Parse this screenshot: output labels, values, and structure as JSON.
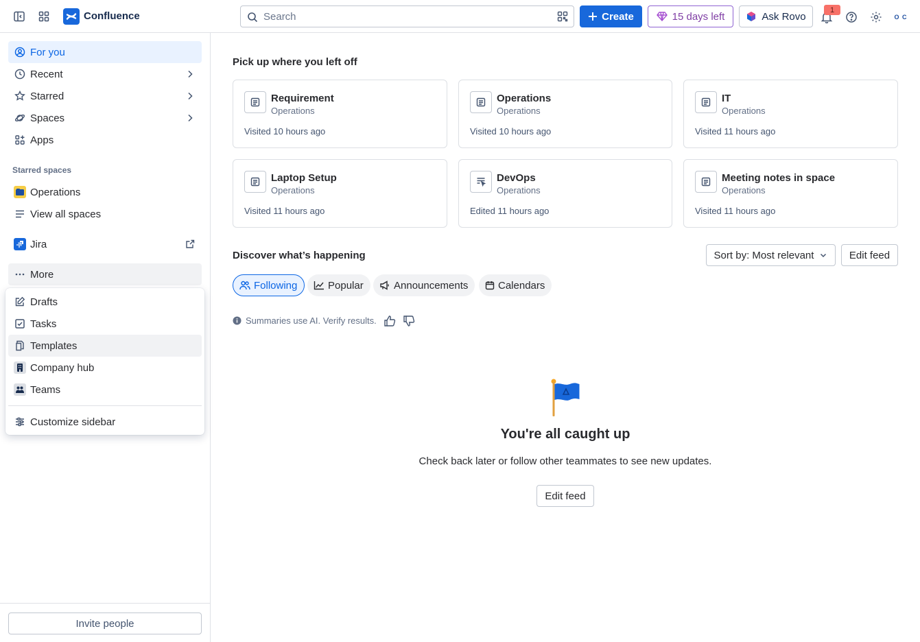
{
  "app": {
    "name": "Confluence",
    "brand_color": "#1868db"
  },
  "topbar": {
    "search_placeholder": "Search",
    "create_label": "Create",
    "trial_label": "15 days left",
    "rovo_label": "Ask Rovo",
    "notification_count": "1",
    "avatar_text": "O C"
  },
  "sidebar": {
    "nav": [
      {
        "label": "For you",
        "icon": "person-circle-icon"
      },
      {
        "label": "Recent",
        "icon": "clock-icon"
      },
      {
        "label": "Starred",
        "icon": "star-icon"
      },
      {
        "label": "Spaces",
        "icon": "planet-icon"
      },
      {
        "label": "Apps",
        "icon": "apps-icon"
      }
    ],
    "starred_spaces_label": "Starred spaces",
    "starred_spaces": [
      {
        "label": "Operations"
      }
    ],
    "view_all_spaces": "View all spaces",
    "jira": "Jira",
    "more": "More",
    "more_menu": [
      {
        "label": "Drafts",
        "icon": "edit-icon"
      },
      {
        "label": "Tasks",
        "icon": "checkbox-icon"
      },
      {
        "label": "Templates",
        "icon": "template-icon"
      },
      {
        "label": "Company hub",
        "icon": "building-icon"
      },
      {
        "label": "Teams",
        "icon": "people-icon"
      }
    ],
    "customize": "Customize sidebar",
    "invite": "Invite people"
  },
  "main": {
    "recent_heading": "Pick up where you left off",
    "recent_cards": [
      {
        "title": "Requirement",
        "space": "Operations",
        "status": "Visited 10 hours ago",
        "icon": "page-icon"
      },
      {
        "title": "Operations",
        "space": "Operations",
        "status": "Visited 10 hours ago",
        "icon": "page-icon"
      },
      {
        "title": "IT",
        "space": "Operations",
        "status": "Visited 11 hours ago",
        "icon": "page-icon"
      },
      {
        "title": "Laptop Setup",
        "space": "Operations",
        "status": "Visited 11 hours ago",
        "icon": "page-icon"
      },
      {
        "title": "DevOps",
        "space": "Operations",
        "status": "Edited 11 hours ago",
        "icon": "page-edit-icon"
      },
      {
        "title": "Meeting notes in space",
        "space": "Operations",
        "status": "Visited 11 hours ago",
        "icon": "page-icon"
      }
    ],
    "discover_heading": "Discover what’s happening",
    "sort_label": "Sort by: Most relevant",
    "edit_feed": "Edit feed",
    "tabs": [
      {
        "label": "Following",
        "active": true
      },
      {
        "label": "Popular"
      },
      {
        "label": "Announcements"
      },
      {
        "label": "Calendars"
      }
    ],
    "ai_note": "Summaries use AI. Verify results.",
    "empty_title": "You're all caught up",
    "empty_subtitle": "Check back later or follow other teammates to see new updates.",
    "empty_button": "Edit feed"
  }
}
